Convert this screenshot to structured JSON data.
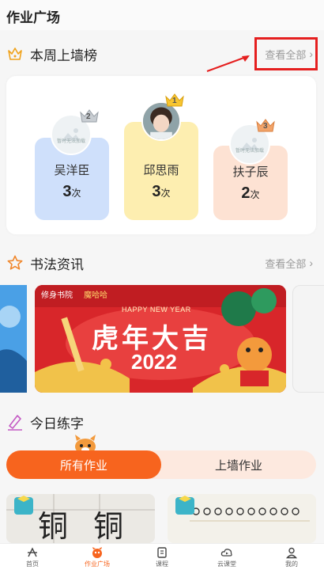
{
  "header": {
    "title": "作业广场"
  },
  "weekly_wall": {
    "title": "本周上墙榜",
    "see_all": "查看全部",
    "ranks": [
      {
        "rank": "2",
        "name": "吴洋臣",
        "count": "3",
        "unit": "次",
        "avatar_label": "暂时无法加载",
        "color": "#cfe0fb"
      },
      {
        "rank": "1",
        "name": "邱思雨",
        "count": "3",
        "unit": "次",
        "color": "#fdeeb0"
      },
      {
        "rank": "3",
        "name": "扶子辰",
        "count": "2",
        "unit": "次",
        "avatar_label": "暂时无法加载",
        "color": "#fde2d3"
      }
    ]
  },
  "news": {
    "title": "书法资讯",
    "see_all": "查看全部",
    "banner": {
      "brand": "修身书院",
      "partner": "魔哈哈",
      "greeting": "HAPPY NEW YEAR",
      "headline": "虎年大吉",
      "year": "2022"
    }
  },
  "today": {
    "title": "今日练字",
    "tabs": [
      {
        "label": "所有作业",
        "active": true
      },
      {
        "label": "上墙作业",
        "active": false
      }
    ],
    "cards": [
      {
        "text": "铜 铜"
      },
      {
        "text": ""
      }
    ]
  },
  "nav": [
    {
      "label": "首页",
      "icon": "home-icon",
      "active": false
    },
    {
      "label": "作业广场",
      "icon": "homework-square-icon",
      "active": true
    },
    {
      "label": "课程",
      "icon": "course-icon",
      "active": false
    },
    {
      "label": "云课堂",
      "icon": "cloud-class-icon",
      "active": false
    },
    {
      "label": "我的",
      "icon": "profile-icon",
      "active": false
    }
  ],
  "colors": {
    "accent": "#f7641e",
    "annotation": "#e51f1f"
  }
}
